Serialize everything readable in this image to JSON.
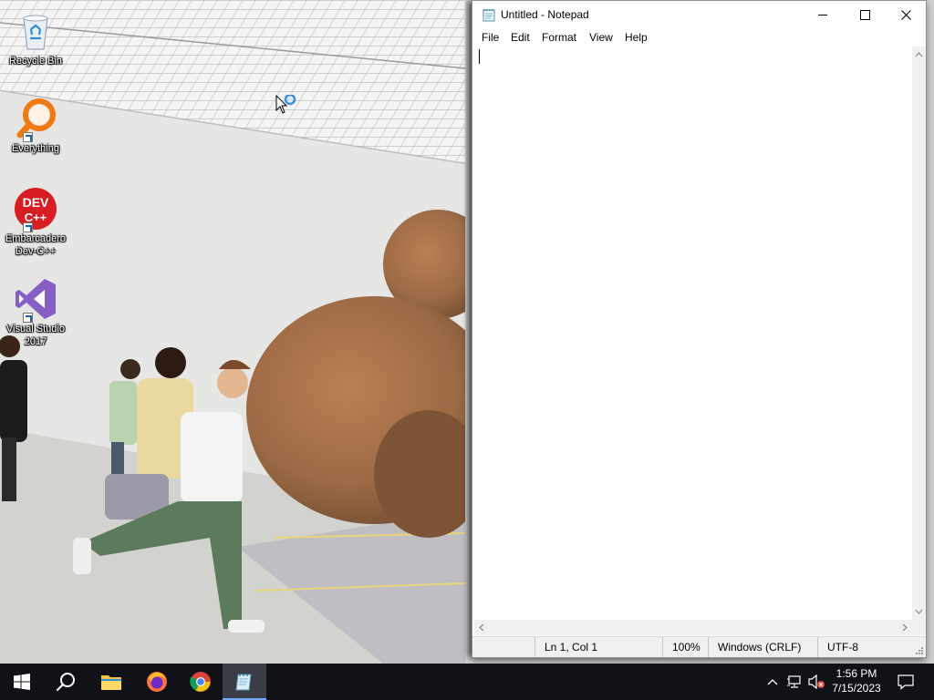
{
  "desktop": {
    "icons": [
      {
        "label": "Recycle Bin"
      },
      {
        "label": "Everything"
      },
      {
        "label": "Embarcadero Dev-C++"
      },
      {
        "label": "Visual Studio 2017"
      }
    ],
    "devcpp_icon_text": "DEV C++"
  },
  "notepad": {
    "title": "Untitled - Notepad",
    "menu": [
      "File",
      "Edit",
      "Format",
      "View",
      "Help"
    ],
    "content": "",
    "status": {
      "position": "Ln 1, Col 1",
      "zoom": "100%",
      "line_ending": "Windows (CRLF)",
      "encoding": "UTF-8"
    }
  },
  "taskbar": {
    "apps": [
      "start-button",
      "search",
      "file-explorer",
      "firefox",
      "chrome",
      "notepad"
    ],
    "clock": {
      "time": "1:56 PM",
      "date": "7/15/2023"
    }
  },
  "colors": {
    "taskbar": "#101218",
    "accent": "#7aa7ff",
    "window_border": "#8f8f8f",
    "statusbar": "#f0f0f0"
  }
}
